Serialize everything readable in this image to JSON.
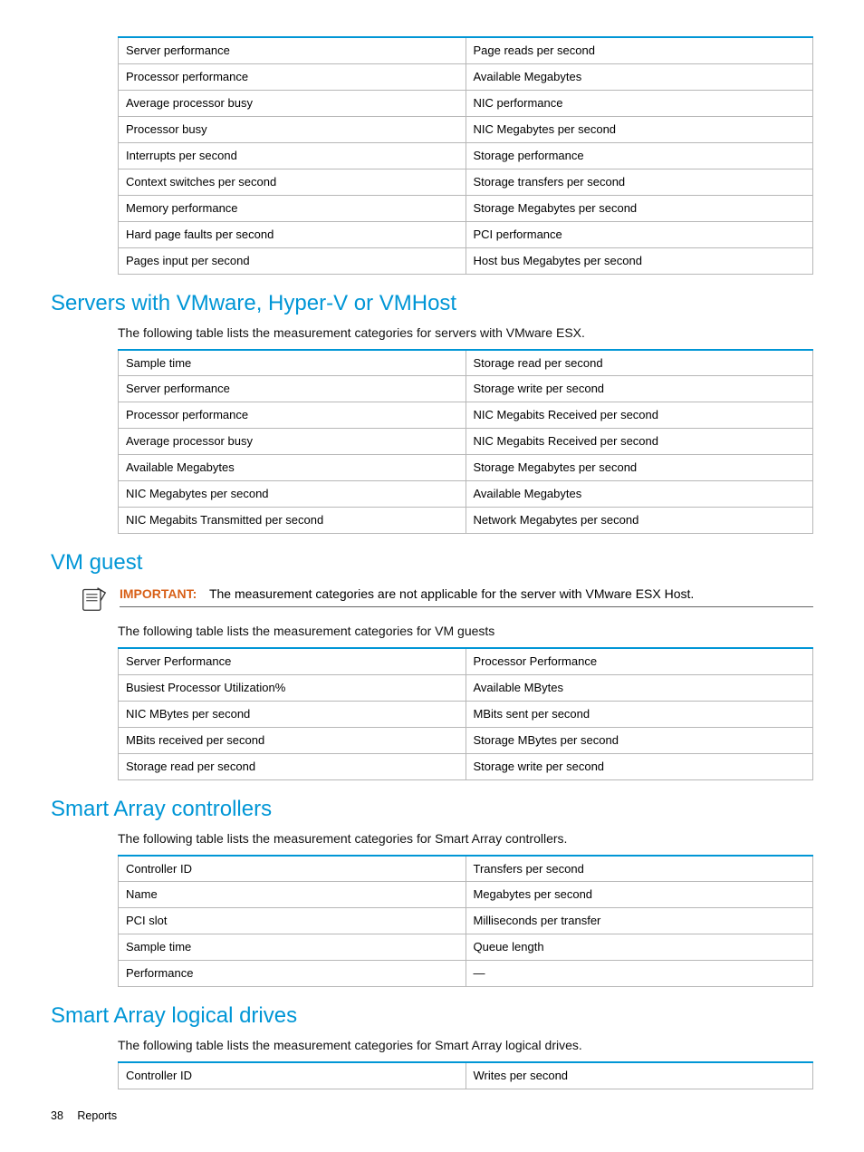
{
  "table1": {
    "rows": [
      [
        "Server performance",
        "Page reads per second"
      ],
      [
        "Processor performance",
        "Available Megabytes"
      ],
      [
        "Average processor busy",
        "NIC performance"
      ],
      [
        "Processor busy",
        "NIC Megabytes per second"
      ],
      [
        "Interrupts per second",
        "Storage performance"
      ],
      [
        "Context switches per second",
        "Storage transfers per second"
      ],
      [
        "Memory performance",
        "Storage Megabytes per second"
      ],
      [
        "Hard page faults per second",
        "PCI performance"
      ],
      [
        "Pages input per second",
        "Host bus Megabytes per second"
      ]
    ]
  },
  "section2": {
    "heading": "Servers with VMware, Hyper-V or VMHost",
    "intro": "The following table lists the measurement categories for servers with VMware ESX.",
    "rows": [
      [
        "Sample time",
        "Storage read per second"
      ],
      [
        "Server performance",
        "Storage write per second"
      ],
      [
        "Processor performance",
        "NIC Megabits Received per second"
      ],
      [
        "Average processor busy",
        "NIC Megabits Received per second"
      ],
      [
        "Available Megabytes",
        "Storage Megabytes per second"
      ],
      [
        "NIC Megabytes per second",
        "Available Megabytes"
      ],
      [
        "NIC Megabits Transmitted per second",
        "Network Megabytes per second"
      ]
    ]
  },
  "section3": {
    "heading": "VM guest",
    "important_label": "IMPORTANT:",
    "important_text": "The measurement categories are not applicable for the server with VMware ESX Host.",
    "intro": "The following table lists the measurement categories for VM guests",
    "rows": [
      [
        "Server Performance",
        "Processor Performance"
      ],
      [
        "Busiest Processor Utilization%",
        "Available MBytes"
      ],
      [
        "NIC MBytes per second",
        "MBits sent per second"
      ],
      [
        "MBits received per second",
        "Storage MBytes per second"
      ],
      [
        "Storage read per second",
        "Storage write per second"
      ]
    ]
  },
  "section4": {
    "heading": "Smart Array controllers",
    "intro": "The following table lists the measurement categories for Smart Array controllers.",
    "rows": [
      [
        "Controller ID",
        "Transfers per second"
      ],
      [
        "Name",
        "Megabytes per second"
      ],
      [
        "PCI slot",
        "Milliseconds per transfer"
      ],
      [
        "Sample time",
        "Queue length"
      ],
      [
        "Performance",
        "—"
      ]
    ]
  },
  "section5": {
    "heading": "Smart Array logical drives",
    "intro": "The following table lists the measurement categories for Smart Array logical drives.",
    "rows": [
      [
        "Controller ID",
        "Writes per second"
      ]
    ]
  },
  "footer": {
    "page": "38",
    "section": "Reports"
  }
}
